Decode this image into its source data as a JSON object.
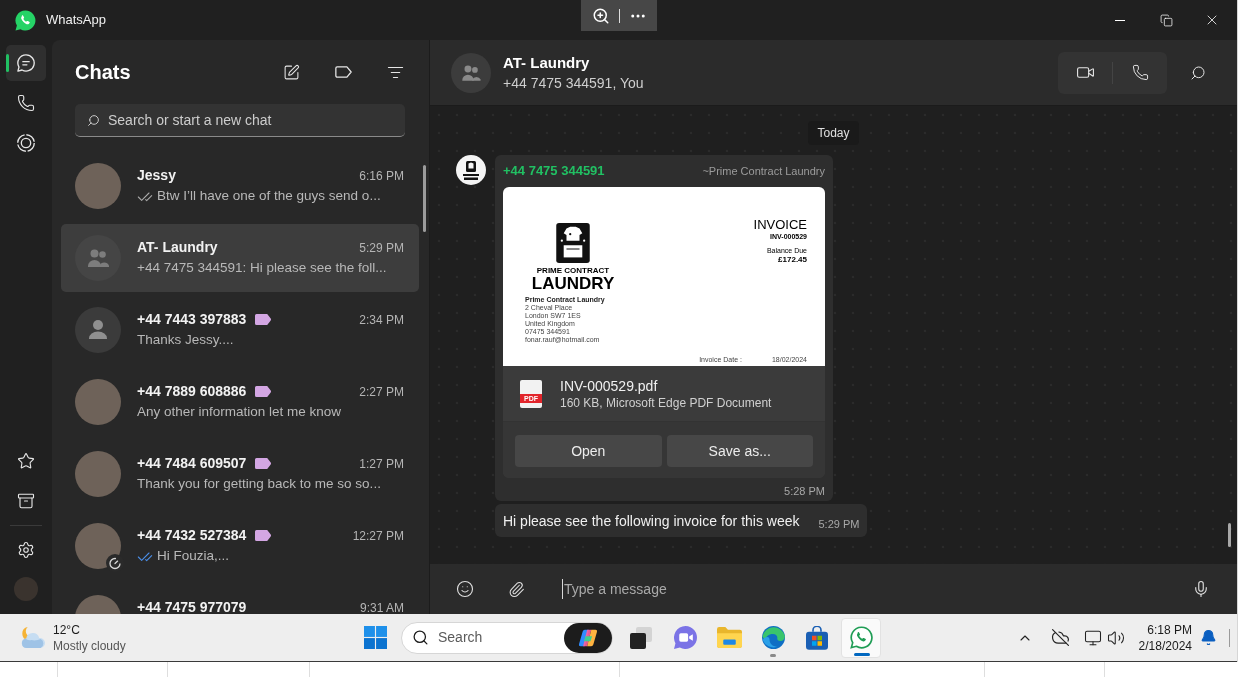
{
  "window": {
    "title": "WhatsApp"
  },
  "nav_rail": {
    "items": [
      {
        "kind": "chats",
        "selected": true
      },
      {
        "kind": "calls",
        "selected": false
      },
      {
        "kind": "status",
        "selected": false
      }
    ]
  },
  "chat_list": {
    "title": "Chats",
    "search": {
      "placeholder": "Search or start a new chat"
    },
    "chats": [
      {
        "kind": "photo",
        "name": "Jessy",
        "time": "6:16 PM",
        "preview": "Btw I’ll have one of the guys send o...",
        "ticks": true,
        "read": false,
        "labeled": false,
        "timer": false,
        "selected": false
      },
      {
        "kind": "group",
        "name": "AT- Laundry",
        "time": "5:29 PM",
        "preview": "+44 7475 344591: Hi please see the foll...",
        "ticks": false,
        "labeled": false,
        "timer": false,
        "selected": true
      },
      {
        "kind": "person",
        "name": "+44 7443 397883",
        "time": "2:34 PM",
        "preview": "Thanks Jessy....",
        "ticks": false,
        "labeled": true,
        "timer": false,
        "selected": false
      },
      {
        "kind": "photo",
        "name": "+44 7889 608886",
        "time": "2:27 PM",
        "preview": "Any other information let me know",
        "ticks": false,
        "labeled": true,
        "timer": false,
        "selected": false
      },
      {
        "kind": "photo",
        "name": "+44 7484 609507",
        "time": "1:27 PM",
        "preview": "Thank you for getting back to me so so...",
        "ticks": false,
        "labeled": true,
        "timer": false,
        "selected": false
      },
      {
        "kind": "photo",
        "name": "+44 7432 527384",
        "time": "12:27 PM",
        "preview": "Hi Fouzia,...",
        "ticks": true,
        "read": true,
        "labeled": true,
        "timer": true,
        "selected": false
      },
      {
        "kind": "photo",
        "name": "+44 7475 977079",
        "time": "9:31 AM",
        "ticks": false,
        "labeled": false,
        "timer": false,
        "selected": false
      }
    ]
  },
  "conversation": {
    "header": {
      "name": "AT- Laundry",
      "subtitle": "+44 7475 344591, You"
    },
    "date_chip": "Today",
    "messages": [
      {
        "kind": "document",
        "sender": "+44 7475 344591",
        "sender_name": "~Prime Contract Laundry",
        "document": {
          "preview": {
            "brand_top": "PRIME CONTRACT",
            "brand_bottom": "LAUNDRY",
            "address": {
              "company": "Prime Contract Laundry",
              "lines": [
                "2 Cheval Place",
                "London SW7 1ES",
                "United Kingdom",
                "07475 344591",
                "fonar.rauf@hotmail.com"
              ]
            },
            "title": "INVOICE",
            "number": "INV-000529",
            "balance_label": "Balance Due",
            "balance": "£172.45",
            "date_label": "Invoice Date :",
            "date": "18/02/2024"
          },
          "file_badge": "PDF",
          "filename": "INV-000529.pdf",
          "details": "160 KB, Microsoft Edge PDF Document",
          "actions": [
            "Open",
            "Save as..."
          ]
        },
        "time": "5:28 PM"
      },
      {
        "kind": "text",
        "text": "Hi please see the following invoice for this week",
        "time": "5:29 PM"
      }
    ],
    "composer": {
      "placeholder": "Type a message"
    }
  },
  "taskbar": {
    "weather": {
      "temperature": "12°C",
      "condition": "Mostly cloudy"
    },
    "search": {
      "placeholder": "Search"
    },
    "apps": [
      {
        "kind": "task-view",
        "running": false,
        "active": false
      },
      {
        "kind": "video-chat",
        "running": false,
        "active": false
      },
      {
        "kind": "folder",
        "running": false,
        "active": false
      },
      {
        "kind": "browser",
        "running": true,
        "active": false
      },
      {
        "kind": "store",
        "running": false,
        "active": false
      },
      {
        "kind": "chat-app",
        "running": true,
        "active": true
      }
    ],
    "clock": {
      "time": "6:18 PM",
      "date": "2/18/2024"
    }
  }
}
